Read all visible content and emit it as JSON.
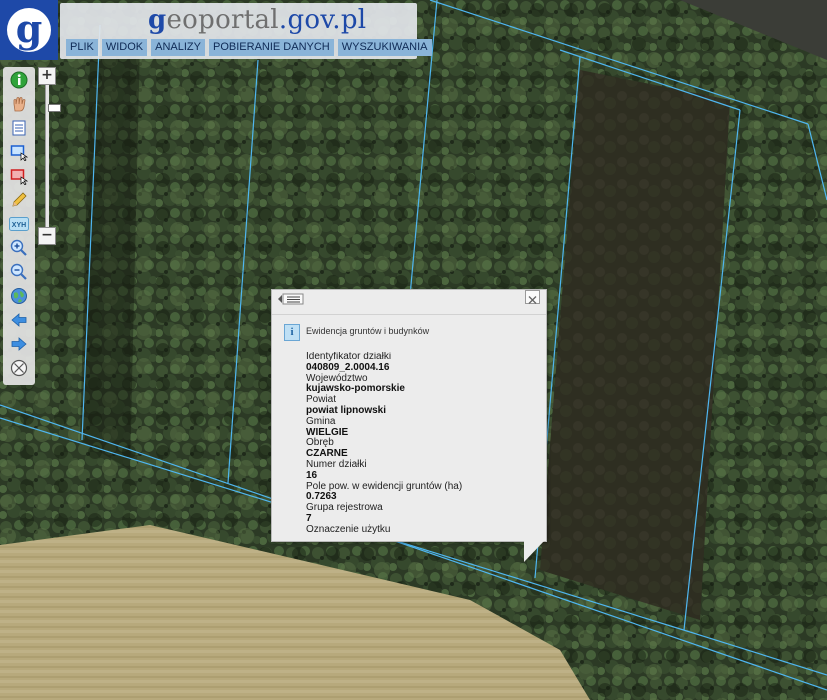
{
  "app": {
    "brand_logo_letter": "g",
    "brand_prefix": "g",
    "brand_name": "eoportal",
    "brand_domain": ".gov.pl"
  },
  "menu": [
    {
      "label": "PLIK"
    },
    {
      "label": "WIDOK"
    },
    {
      "label": "ANALIZY"
    },
    {
      "label": "POBIERANIE DANYCH"
    },
    {
      "label": "WYSZUKIWANIA"
    }
  ],
  "toolbar": {
    "tools": [
      {
        "icon": "info-icon"
      },
      {
        "icon": "hand-pan-icon"
      },
      {
        "icon": "legend-list-icon"
      },
      {
        "icon": "select-rectangle-icon"
      },
      {
        "icon": "clear-selection-icon"
      },
      {
        "icon": "pencil-measure-icon"
      },
      {
        "icon": "xyh-coordinates-icon"
      },
      {
        "icon": "zoom-in-icon"
      },
      {
        "icon": "zoom-out-icon"
      },
      {
        "icon": "globe-full-extent-icon"
      },
      {
        "icon": "arrow-back-icon"
      },
      {
        "icon": "arrow-forward-icon"
      },
      {
        "icon": "compass-icon"
      }
    ],
    "xyh_label": "XYH"
  },
  "zoom": {
    "plus": "+",
    "minus": "−",
    "level": 0.14
  },
  "popup": {
    "section_title": "Ewidencja gruntów i budynków",
    "fields": [
      {
        "label": "Identyfikator działki",
        "value": "040809_2.0004.16"
      },
      {
        "label": "Województwo",
        "value": "kujawsko-pomorskie"
      },
      {
        "label": "Powiat",
        "value": "powiat lipnowski"
      },
      {
        "label": "Gmina",
        "value": "WIELGIE"
      },
      {
        "label": "Obręb",
        "value": "CZARNE"
      },
      {
        "label": "Numer działki",
        "value": "16"
      },
      {
        "label": "Pole pow. w ewidencji gruntów (ha)",
        "value": "0.7263"
      },
      {
        "label": "Grupa rejestrowa",
        "value": "7"
      },
      {
        "label": "Oznaczenie użytku",
        "value": ""
      }
    ]
  },
  "colors": {
    "brand_blue": "#1e49a8",
    "parcel_line": "#4fb6f0",
    "menu_bg": "#8ab4d8"
  }
}
